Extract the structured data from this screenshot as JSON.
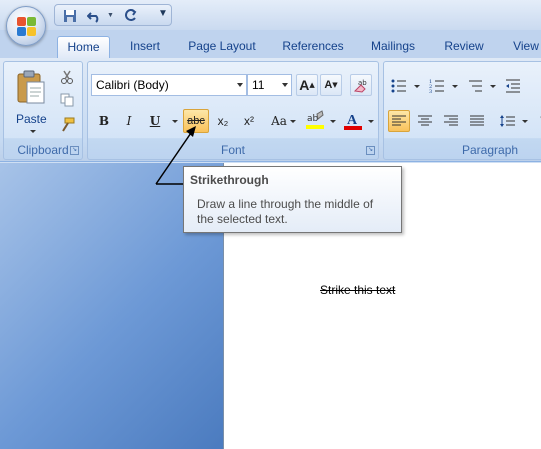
{
  "tabs": [
    {
      "label": "Home"
    },
    {
      "label": "Insert"
    },
    {
      "label": "Page Layout"
    },
    {
      "label": "References"
    },
    {
      "label": "Mailings"
    },
    {
      "label": "Review"
    },
    {
      "label": "View"
    }
  ],
  "active_tab": "Home",
  "clipboard": {
    "paste_label": "Paste",
    "group_label": "Clipboard"
  },
  "font": {
    "font_name": "Calibri (Body)",
    "font_size": "11",
    "group_label": "Font",
    "buttons": {
      "bold": "B",
      "italic": "I",
      "underline": "U",
      "strikethrough": "abc",
      "subscript": "x₂",
      "superscript": "x²",
      "change_case": "Aa",
      "grow_font": "A",
      "shrink_font": "A"
    },
    "highlight_color": "#ffff00",
    "font_color": "#e00000"
  },
  "paragraph": {
    "group_label": "Paragraph"
  },
  "tooltip": {
    "title": "Strikethrough",
    "description": "Draw a line through the middle of the selected text."
  },
  "document": {
    "text": "Strike this text"
  },
  "colors": {
    "accent": "#15428b",
    "hover": "#f9c25b"
  }
}
